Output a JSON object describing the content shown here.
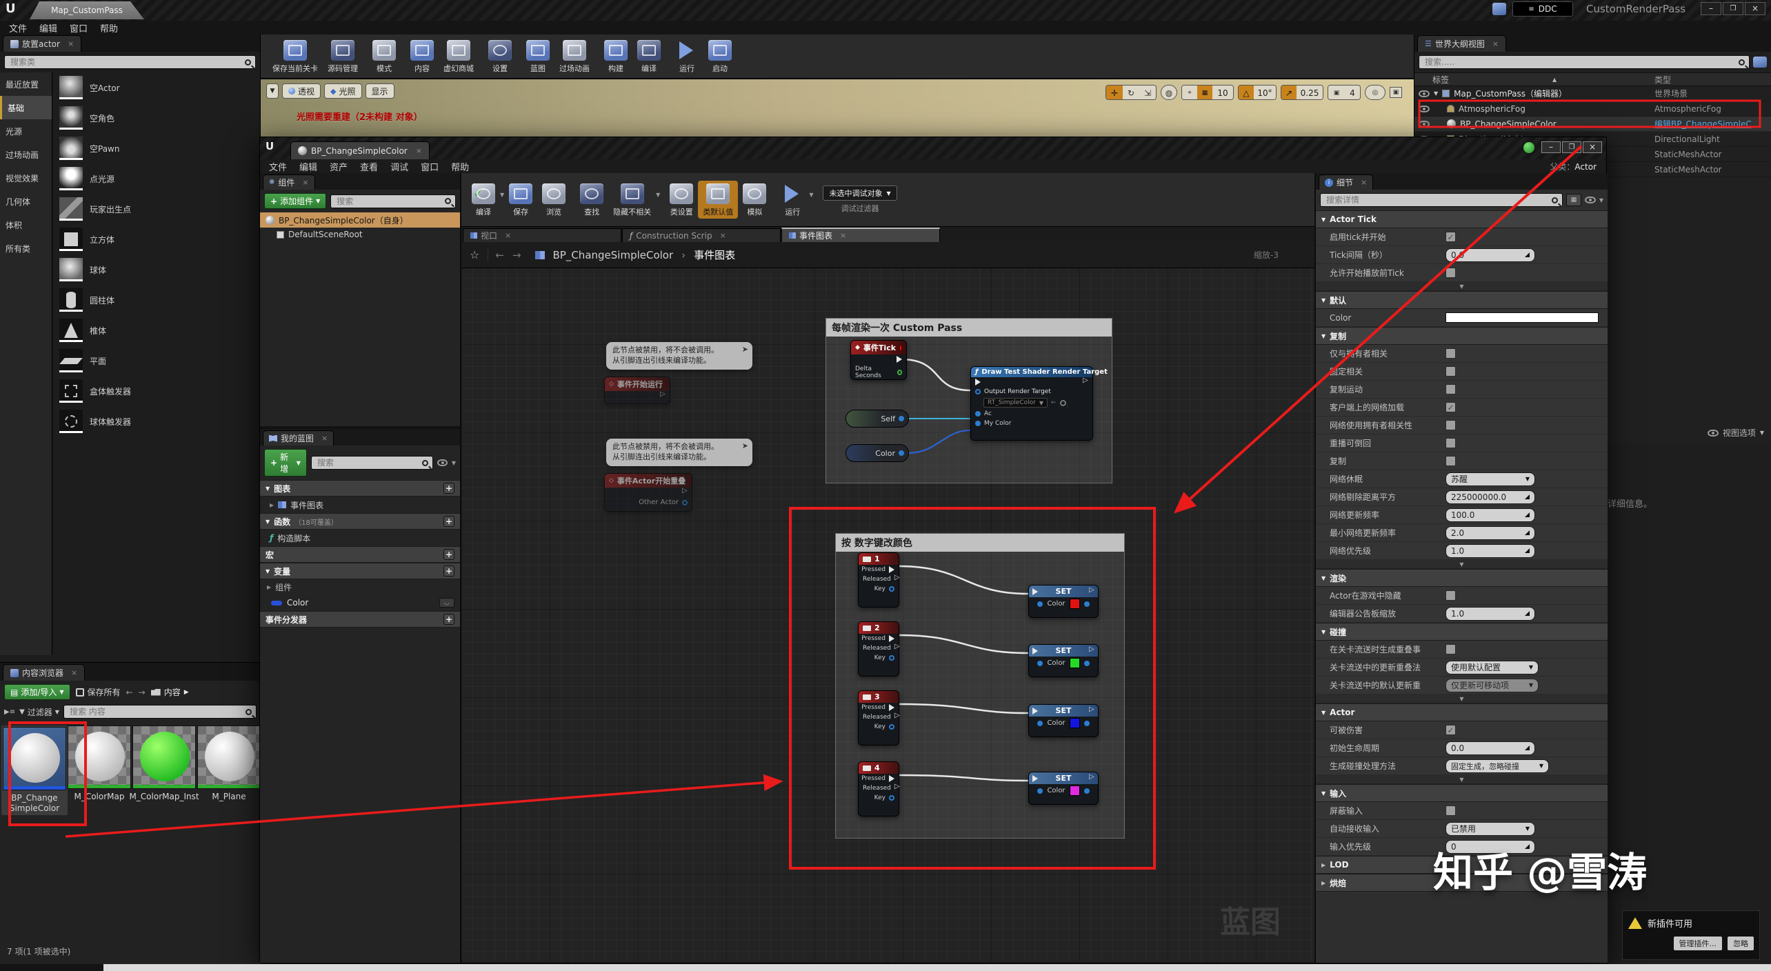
{
  "titlebar": {
    "level_tab": "Map_CustomPass",
    "ddc": "DDC",
    "project": "CustomRenderPass",
    "min": "–",
    "max": "❐",
    "close": "×"
  },
  "menus": {
    "main": [
      "文件",
      "编辑",
      "窗口",
      "帮助"
    ],
    "bp": [
      "文件",
      "编辑",
      "资产",
      "查看",
      "调试",
      "窗口",
      "帮助"
    ]
  },
  "place_panel": {
    "title": "放置actor",
    "search": "搜索类",
    "categories": [
      "最近放置",
      "基础",
      "光源",
      "过场动画",
      "视觉效果",
      "几何体",
      "体积",
      "所有类"
    ],
    "items": [
      "空Actor",
      "空角色",
      "空Pawn",
      "点光源",
      "玩家出生点",
      "立方体",
      "球体",
      "圆柱体",
      "椎体",
      "平面",
      "盒体触发器",
      "球体触发器"
    ]
  },
  "main_toolbar": {
    "buttons": [
      "保存当前关卡",
      "源码管理",
      "模式",
      "内容",
      "虚幻商城",
      "设置",
      "蓝图",
      "过场动画",
      "构建",
      "编译",
      "运行",
      "启动"
    ]
  },
  "viewport": {
    "persp": "透视",
    "lit": "光照",
    "show": "显示",
    "warning": "光照需要重建（2未构建 对象）",
    "grid": "10",
    "angle": "10°",
    "scale": "0.25",
    "cam": "4"
  },
  "outliner": {
    "title": "世界大纲视图",
    "search": "搜索.....",
    "cols": {
      "label": "标签",
      "type": "类型"
    },
    "rows": [
      {
        "label": "Map_CustomPass（编辑器）",
        "type": "世界场景"
      },
      {
        "label": "AtmosphericFog",
        "type": "AtmosphericFog"
      },
      {
        "label": "BP_ChangeSimpleColor",
        "type": "编辑BP_ChangeSimpleC"
      },
      {
        "label": "DirectionalLight",
        "type": "DirectionalLight"
      },
      {
        "label": "StaticMeshActor",
        "type": "StaticMeshActor"
      },
      {
        "label": "StaticMeshActor",
        "type": "StaticMeshActor"
      }
    ],
    "view_options": "视图选项",
    "hint": "详细信息。"
  },
  "bp": {
    "tab": "BP_ChangeSimpleColor",
    "parent_label": "父类：",
    "parent_value": "Actor",
    "toolbar": {
      "compile": "编译",
      "save": "保存",
      "browse": "浏览",
      "find": "查找",
      "hide_unrelated": "隐藏不相关",
      "class_settings": "类设置",
      "class_defaults": "类默认值",
      "simulate": "模拟",
      "play": "运行",
      "debug_object": "未选中调试对象",
      "debug_filter": "调试过滤器"
    },
    "components": {
      "title": "组件",
      "add": "添加组件",
      "search": "搜索",
      "rows": [
        "BP_ChangeSimpleColor（自身）",
        "DefaultSceneRoot"
      ]
    },
    "myblueprint": {
      "title": "我的蓝图",
      "add": "新增",
      "search": "搜索",
      "graphs": "图表",
      "event_graph": "事件图表",
      "functions": "函数",
      "overridable": "（18可覆盖）",
      "construction": "构造脚本",
      "macros": "宏",
      "variables": "变量",
      "components_group": "组件",
      "color_var": "Color",
      "dispatchers": "事件分发器"
    },
    "tabs": [
      "视口",
      "Construction Scrip",
      "事件图表"
    ],
    "crumb": {
      "root": "BP_ChangeSimpleColor",
      "sep": "›",
      "leaf": "事件图表",
      "zoom": "缩放-3"
    },
    "watermark": "蓝图"
  },
  "graph": {
    "comment_top": "每帧渲染一次 Custom Pass",
    "comment_bottom": "按 数字键改颜色",
    "disabled1": "此节点被禁用，将不会被调用。",
    "disabled2": "从引脚连出引线来编译功能。",
    "event_begin": "事件开始运行",
    "event_overlap": "事件Actor开始重叠",
    "other_actor": "Other Actor",
    "tick_title": "事件Tick",
    "delta": "Delta Seconds",
    "draw_title": "Draw Test Shader Render Target",
    "out_rt": "Output Render Target",
    "rt_value": "RT_SimpleColor",
    "pin_ac": "Ac",
    "pin_mycolor": "My Color",
    "self_pill": "Self",
    "color_pill": "Color",
    "pressed": "Pressed",
    "released": "Released",
    "key": "Key",
    "set_label": "SET",
    "color_label": "Color",
    "keys": [
      {
        "num": "1",
        "color": "#e01212"
      },
      {
        "num": "2",
        "color": "#25d825"
      },
      {
        "num": "3",
        "color": "#1515e0"
      },
      {
        "num": "4",
        "color": "#e02ae0"
      }
    ]
  },
  "details": {
    "title": "细节",
    "search": "搜索详情",
    "sections": [
      {
        "name": "Actor Tick",
        "rows": [
          {
            "label": "启用tick并开始",
            "kind": "check",
            "checked": true
          },
          {
            "label": "Tick间隔（秒）",
            "kind": "num",
            "value": "0.0"
          },
          {
            "label": "允许开始播放前Tick",
            "kind": "check",
            "checked": false
          }
        ]
      },
      {
        "name": "默认",
        "rows": [
          {
            "label": "Color",
            "kind": "colorbar",
            "value": "#ffffff"
          }
        ]
      },
      {
        "name": "复制",
        "rows": [
          {
            "label": "仅与拥有者相关",
            "kind": "check",
            "checked": false
          },
          {
            "label": "固定相关",
            "kind": "check",
            "checked": false
          },
          {
            "label": "复制运动",
            "kind": "check",
            "checked": false
          },
          {
            "label": "客户端上的网络加载",
            "kind": "check",
            "checked": true
          },
          {
            "label": "网络使用拥有者相关性",
            "kind": "check",
            "checked": false
          },
          {
            "label": "重播可倒回",
            "kind": "check",
            "checked": false
          },
          {
            "label": "复制",
            "kind": "check",
            "checked": false
          },
          {
            "label": "网络休眠",
            "kind": "drop",
            "value": "苏醒"
          },
          {
            "label": "网络剔除距离平方",
            "kind": "num",
            "value": "225000000.0"
          },
          {
            "label": "网络更新频率",
            "kind": "num",
            "value": "100.0"
          },
          {
            "label": "最小网络更新频率",
            "kind": "num",
            "value": "2.0"
          },
          {
            "label": "网络优先级",
            "kind": "num",
            "value": "1.0"
          }
        ]
      },
      {
        "name": "渲染",
        "rows": [
          {
            "label": "Actor在游戏中隐藏",
            "kind": "check",
            "checked": false
          },
          {
            "label": "编辑器公告板缩放",
            "kind": "num",
            "value": "1.0"
          }
        ]
      },
      {
        "name": "碰撞",
        "rows": [
          {
            "label": "在关卡流送时生成重叠事",
            "kind": "check",
            "checked": false
          },
          {
            "label": "关卡流送中的更新重叠法",
            "kind": "drop",
            "value": "使用默认配置"
          },
          {
            "label": "关卡流送中的默认更新重",
            "kind": "drop",
            "value": "仅更新可移动项"
          }
        ]
      },
      {
        "name": "Actor",
        "rows": [
          {
            "label": "可被伤害",
            "kind": "check",
            "checked": true
          },
          {
            "label": "初始生命周期",
            "kind": "num",
            "value": "0.0"
          },
          {
            "label": "生成碰撞处理方法",
            "kind": "drop",
            "value": "固定生成，忽略碰撞"
          }
        ]
      },
      {
        "name": "输入",
        "rows": [
          {
            "label": "屏蔽输入",
            "kind": "check",
            "checked": false
          },
          {
            "label": "自动接收输入",
            "kind": "drop",
            "value": "已禁用"
          },
          {
            "label": "输入优先级",
            "kind": "num",
            "value": "0"
          }
        ]
      },
      {
        "name": "LOD",
        "rows": []
      },
      {
        "name": "烘焙",
        "rows": []
      }
    ]
  },
  "content_browser": {
    "title": "内容浏览器",
    "add": "添加/导入",
    "save_all": "保存所有",
    "path": "内容",
    "filters": "过滤器",
    "search": "搜索 内容",
    "status": "7 项(1 项被选中)",
    "assets": [
      "BP_Change SimpleColor",
      "M_ColorMap",
      "M_ColorMap_Inst",
      "M_Plane"
    ]
  },
  "toast": {
    "title": "新插件可用",
    "manage": "管理插件...",
    "ignore": "忽略"
  },
  "watermark": "知乎 @雪涛"
}
